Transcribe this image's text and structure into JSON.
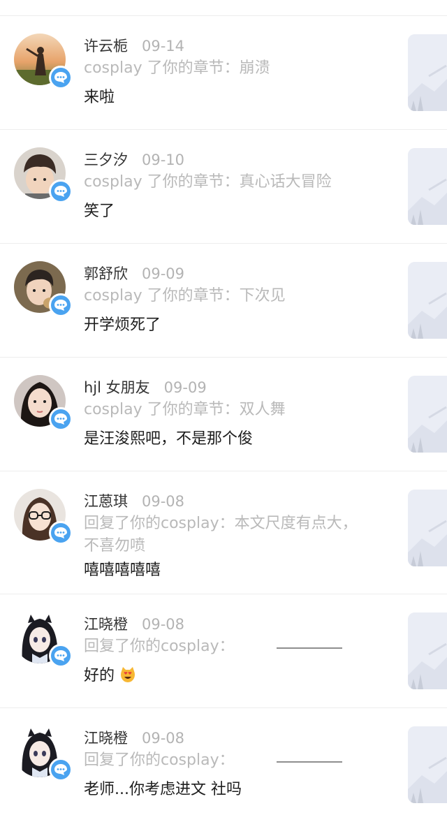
{
  "colors": {
    "badge": "#4aa3f0",
    "date": "#b3b3b3",
    "ref": "#b9b9b9",
    "text": "#1d1d1d"
  },
  "items": [
    {
      "name": "许云栀",
      "date": "09-14",
      "ref": "cosplay 了你的章节：崩溃",
      "message": "来啦",
      "avatar_icon": "avatar-sunset-photo"
    },
    {
      "name": "三夕汐",
      "date": "09-10",
      "ref": "cosplay 了你的章节：真心话大冒险",
      "message": "笑了",
      "avatar_icon": "avatar-boy-photo"
    },
    {
      "name": "郭舒欣",
      "date": "09-09",
      "ref": "cosplay 了你的章节：下次见",
      "message": "开学烦死了",
      "avatar_icon": "avatar-girl-photo"
    },
    {
      "name": "hjl 女朋友",
      "date": "09-09",
      "ref": "cosplay 了你的章节：双人舞",
      "message": "是汪浚熙吧，不是那个俊",
      "avatar_icon": "avatar-girl-dark-hair-photo"
    },
    {
      "name": "江蒽琪",
      "date": "09-08",
      "ref": "回复了你的cosplay：本文尺度有点大，",
      "ref_line2": "不喜勿喷",
      "message": "嘻嘻嘻嘻嘻",
      "avatar_icon": "avatar-glasses-girl-photo"
    },
    {
      "name": "江晓橙",
      "date": "09-08",
      "ref": "回复了你的cosplay：",
      "message": "好的",
      "emoji": "heart-eyes-cat-emoji",
      "avatar_icon": "avatar-anime-girl"
    },
    {
      "name": "江晓橙",
      "date": "09-08",
      "ref": "回复了你的cosplay：",
      "message": "老师...你考虑进文  社吗",
      "avatar_icon": "avatar-anime-girl"
    }
  ]
}
